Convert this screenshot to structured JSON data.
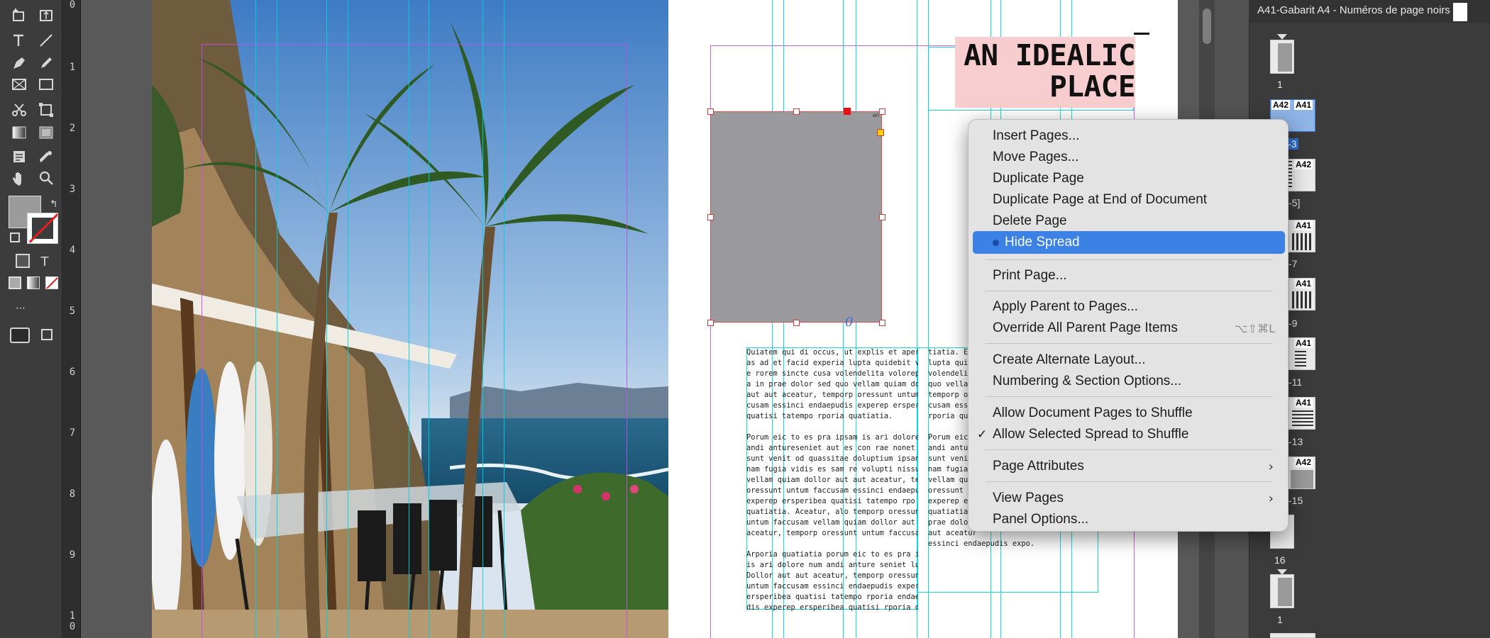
{
  "toolbar": {
    "tools": [
      "page-tool-icon",
      "gap-tool-icon",
      "type-tool-icon",
      "line-tool-icon",
      "pen-tool-icon",
      "pencil-tool-icon",
      "frame-tool-icon",
      "rectangle-tool-icon",
      "scissors-tool-icon",
      "transform-tool-icon",
      "gradient-tool-icon",
      "gradient-feather-icon",
      "note-tool-icon",
      "eyedropper-icon",
      "hand-tool-icon",
      "zoom-tool-icon"
    ]
  },
  "ruler": {
    "numbers": [
      "0",
      "1",
      "2",
      "3",
      "4",
      "5",
      "6",
      "7",
      "8",
      "9",
      "1\n0"
    ]
  },
  "spread": {
    "headline_line1": "AN IDEALIC",
    "headline_line2": "PLACE",
    "frame_label": "an",
    "overset_marker": "0",
    "col1": [
      "Quiatem qui di occus, ut explis et apernatis\nas ad et facid experia lupta quidebit volorep\ne rorem sincte cusa volendelita voloreptis\na in prae dolor sed quo vellam quiam dollor\naut aut aceatur, temporp oressunt untum fac-\ncusam essinci endaepudis experep ersperibea\nquatisi tatempo rporia quatiatia.",
      "Porum eic to es pra ipsam is ari dolore num\nandi antureseniet aut es con rae nonet latur\nsunt venit od quassitae doluptium ipsande\nnam fugia vidis es sam re volupti nissunt.\nvellam quiam dollor aut aut aceatur, temporp\noressunt untum faccusam essinci endaepu dis\nexperep ersperibea quatisi tatempo rpo ria\nquatiatia. Aceatur, alo temporp oressunt\nuntum faccusam vellam quiam dollor aut aut\naceatur, temporp oressunt untum faccusa.",
      "Arporia quatiatia porum eic to es pra ipsam\nis ari dolore num andi anture seniet lunt.\nDollor aut aut aceatur, temporp oressunt\nuntum faccusam essinci endaepudis experep\nersperibea quatisi tatempo rporia endaepu-\ndis experep ersperibea quatisi rporia qua-"
    ],
    "col2": [
      "tiatia. Ex\nlupta quid\nvolendelit\nquo vellam\ntemporp or\ncusam ess\nrporia qua",
      "Porum eic t\nandi anture\nsunt venit\nnam fugia\nvellam quia\noressunt u\nexperep e\nquatiatia.\nprae dolor\naut aceatur\nessinci endaepudis expo."
    ]
  },
  "context_menu": {
    "items": [
      {
        "label": "Insert Pages..."
      },
      {
        "label": "Move Pages..."
      },
      {
        "label": "Duplicate Page"
      },
      {
        "label": "Duplicate Page at End of Document"
      },
      {
        "label": "Delete Page"
      },
      {
        "label": "Hide Spread",
        "highlighted": true
      },
      {
        "label": "Print Page..."
      },
      {
        "label": "Apply Parent to Pages..."
      },
      {
        "label": "Override All Parent Page Items",
        "shortcut": "⌥⇧⌘L"
      },
      {
        "label": "Create Alternate Layout..."
      },
      {
        "label": "Numbering & Section Options..."
      },
      {
        "label": "Allow Document Pages to Shuffle"
      },
      {
        "label": "Allow Selected Spread to Shuffle",
        "checked": true,
        "check_mark": "✓"
      },
      {
        "label": "Page Attributes",
        "submenu": true,
        "arrow": "›"
      },
      {
        "label": "View Pages",
        "submenu": true,
        "arrow": "›"
      },
      {
        "label": "Panel Options..."
      }
    ]
  },
  "pages_panel": {
    "parent_name": "A41-Gabarit A4 - Numéros de page noirs",
    "page_labels": [
      "1",
      "-3",
      "-5]",
      "-7",
      "-9",
      "-11",
      "-13",
      "-15",
      "16",
      "1"
    ],
    "tags": [
      "A42",
      "A41",
      "A42",
      "A41",
      "A41",
      "A41",
      "A41",
      "A42"
    ]
  },
  "colors": {
    "accent": "#3b82e4",
    "headline_bg": "#f7cdd0",
    "guide_cyan": "#00d2dc",
    "guide_margin": "#be50e6"
  }
}
